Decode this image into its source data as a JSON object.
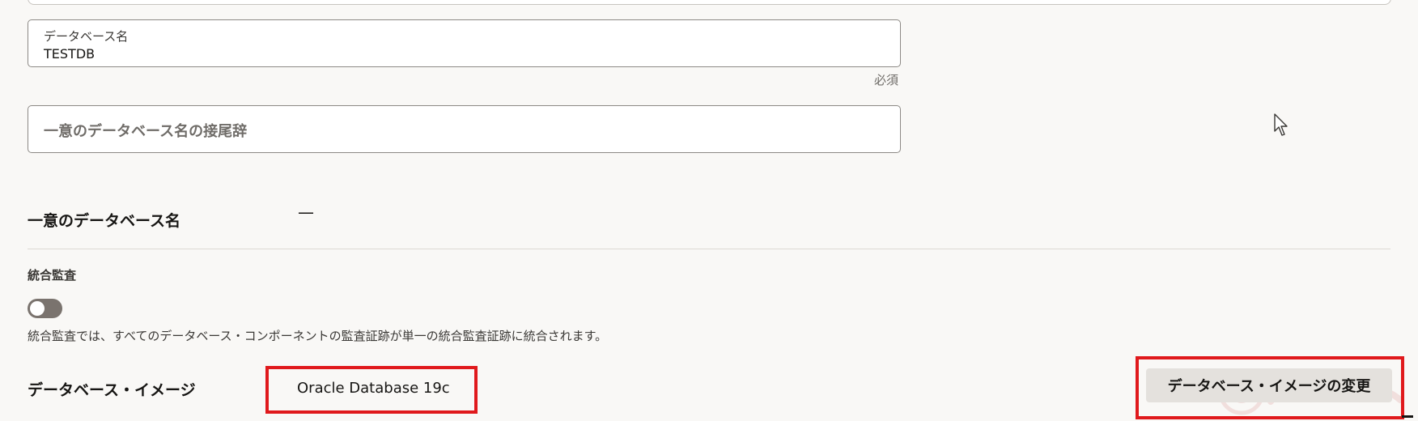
{
  "database_name_field": {
    "label": "データベース名",
    "value": "TESTDB",
    "required_note": "必須"
  },
  "unique_suffix_field": {
    "placeholder": "一意のデータベース名の接尾辞"
  },
  "unique_database_name": {
    "label": "一意のデータベース名",
    "value": "—"
  },
  "unified_audit": {
    "label": "統合監査",
    "enabled": false,
    "description": "統合監査では、すべてのデータベース・コンポーネントの監査証跡が単一の統合監査証跡に統合されます。"
  },
  "database_image": {
    "label": "データベース・イメージ",
    "value": "Oracle Database 19c",
    "change_button_label": "データベース・イメージの変更"
  },
  "colors": {
    "background": "#f9f8f6",
    "highlight": "#e0191c",
    "toggle_off": "#7a736e",
    "button_bg": "#e4e1dd"
  },
  "icons": {
    "cursor": "mouse-pointer-icon",
    "watermark": "watermark-logo"
  }
}
